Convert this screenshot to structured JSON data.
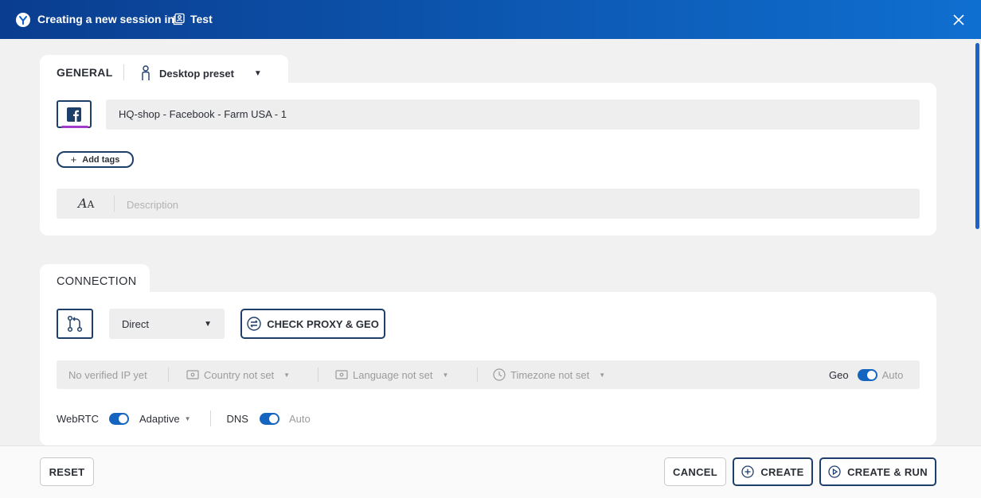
{
  "header": {
    "title": "Creating a new session in",
    "folder": "Test",
    "icons": {
      "app": "app-logo-icon",
      "folder": "folder-profile-icon",
      "close": "close-icon"
    }
  },
  "general": {
    "tab_label": "GENERAL",
    "preset_label": "Desktop preset",
    "profile_name": "HQ-shop - Facebook - Farm USA - 1",
    "add_tags_label": "Add tags",
    "description_placeholder": "Description"
  },
  "connection": {
    "tab_label": "CONNECTION",
    "type_value": "Direct",
    "check_proxy_label": "CHECK PROXY & GEO",
    "ip_status": "No verified IP yet",
    "country": "Country not set",
    "language": "Language not set",
    "timezone": "Timezone not set",
    "geo_label": "Geo",
    "geo_mode": "Auto",
    "webrtc_label": "WebRTC",
    "webrtc_mode": "Adaptive",
    "dns_label": "DNS",
    "dns_mode": "Auto"
  },
  "footer": {
    "reset_label": "RESET",
    "cancel_label": "CANCEL",
    "create_label": "CREATE",
    "create_run_label": "CREATE & RUN"
  },
  "colors": {
    "header_start": "#0a3d8f",
    "header_end": "#0f6fd0",
    "accent": "#1565c0",
    "outline": "#1f3f6b",
    "facebook_underline": "#a23bc9"
  }
}
